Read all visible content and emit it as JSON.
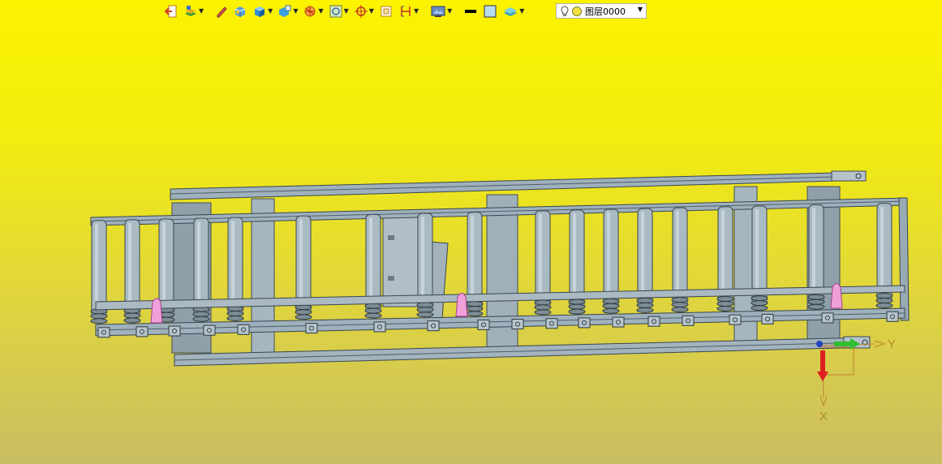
{
  "toolbar": {
    "items": [
      {
        "icon": "exit-icon"
      },
      {
        "icon": "layer-stack-icon",
        "dropdown": true
      },
      {
        "icon": "pencil-icon"
      },
      {
        "icon": "solid-cube-icon"
      },
      {
        "icon": "shaded-cube-icon",
        "dropdown": true
      },
      {
        "icon": "render-mode-icon",
        "dropdown": true
      },
      {
        "icon": "section-view-icon",
        "dropdown": true
      },
      {
        "icon": "view-orient-icon",
        "dropdown": true
      },
      {
        "icon": "snap-target-icon",
        "dropdown": true
      },
      {
        "icon": "frame-select-icon"
      },
      {
        "icon": "dimension-icon",
        "dropdown": true
      },
      {
        "icon": "display-panel-icon",
        "dropdown": true
      },
      {
        "icon": "line-color-icon"
      },
      {
        "icon": "fill-color-icon"
      },
      {
        "icon": "layer-panel-icon",
        "dropdown": true
      }
    ],
    "layer_name": "图层0000"
  },
  "viewport": {
    "background_top": "#fbf300",
    "background_bottom": "#c9bd64",
    "axes": {
      "x_label": "X",
      "y_label": "Y"
    }
  }
}
